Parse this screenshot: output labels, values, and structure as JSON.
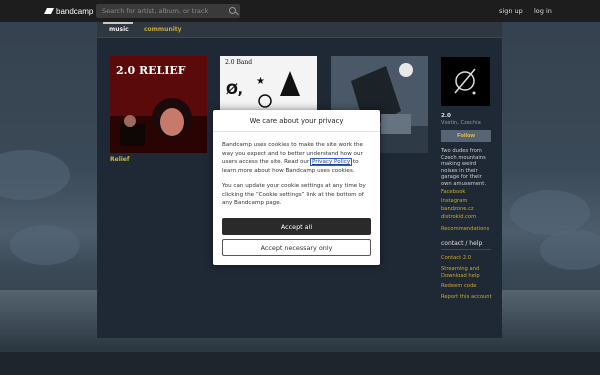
{
  "header": {
    "logo_text": "bandcamp",
    "search_placeholder": "Search for artist, album, or track",
    "signup_label": "sign up",
    "login_label": "log in"
  },
  "tabs": {
    "music": "music",
    "community": "community"
  },
  "albums": [
    {
      "title": "Relief",
      "cover_text": "2.0 RELIEF"
    },
    {
      "title": "",
      "cover_text": "2.0 Band"
    },
    {
      "title": "",
      "cover_text": ""
    }
  ],
  "artist": {
    "name": "2.0",
    "location": "Vsetin, Czechia",
    "follow_label": "Follow",
    "bio": "Two dudes from Czech mountains making weird noises in their garage for their own amusement.",
    "links": [
      "Facebook",
      "Instagram",
      "bandzone.cz",
      "distrokid.com"
    ],
    "recommendations_label": "Recommendations",
    "contact_heading": "contact / help",
    "contact_links": [
      "Contact 2.0",
      "Streaming and Download help",
      "Redeem code",
      "Report this account"
    ]
  },
  "cookie_dialog": {
    "title": "We care about your privacy",
    "body_1a": "Bandcamp uses cookies to make the site work the way you expect and to better understand how our users access the site. Read our ",
    "policy_link": "Privacy Policy",
    "body_1b": " to learn more about how Bandcamp uses cookies.",
    "body_2": "You can update your cookie settings at any time by clicking the “Cookie settings” link at the bottom of any Bandcamp page.",
    "accept_all": "Accept all",
    "accept_necessary": "Accept necessary only"
  },
  "colors": {
    "accent": "#c9a92e",
    "topbar": "#1d1d1d",
    "panel": "#1f2935"
  }
}
